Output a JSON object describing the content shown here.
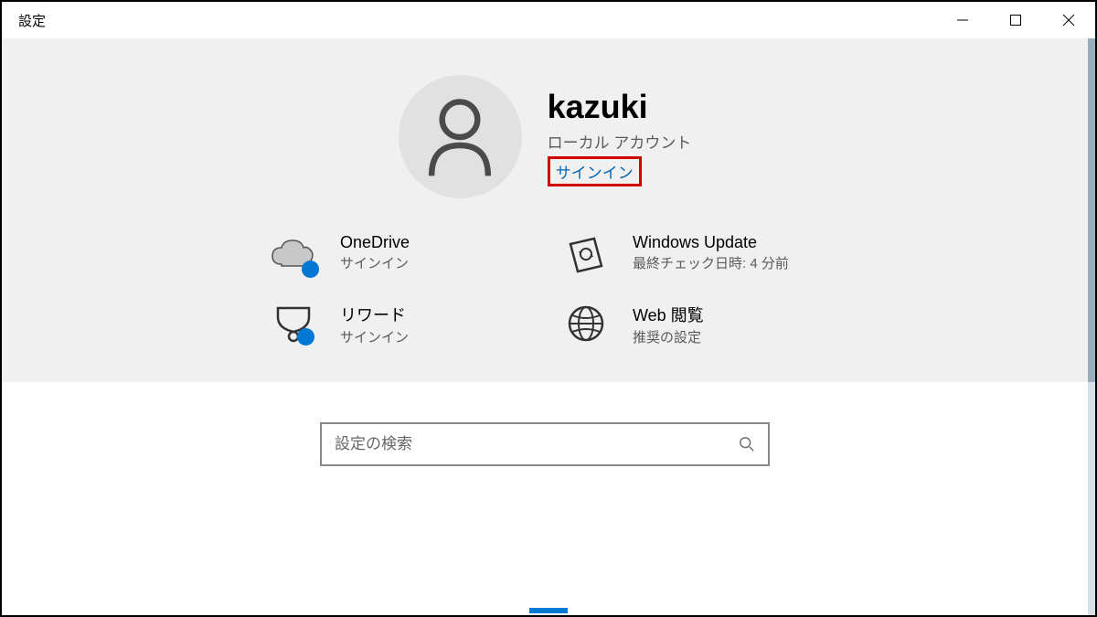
{
  "window": {
    "title": "設定"
  },
  "profile": {
    "username": "kazuki",
    "account_type": "ローカル アカウント",
    "signin_label": "サインイン"
  },
  "services": {
    "onedrive": {
      "title": "OneDrive",
      "sub": "サインイン"
    },
    "windows_update": {
      "title": "Windows Update",
      "sub": "最終チェック日時: 4 分前"
    },
    "rewards": {
      "title": "リワード",
      "sub": "サインイン"
    },
    "web": {
      "title": "Web 閲覧",
      "sub": "推奨の設定"
    }
  },
  "search": {
    "placeholder": "設定の検索"
  }
}
